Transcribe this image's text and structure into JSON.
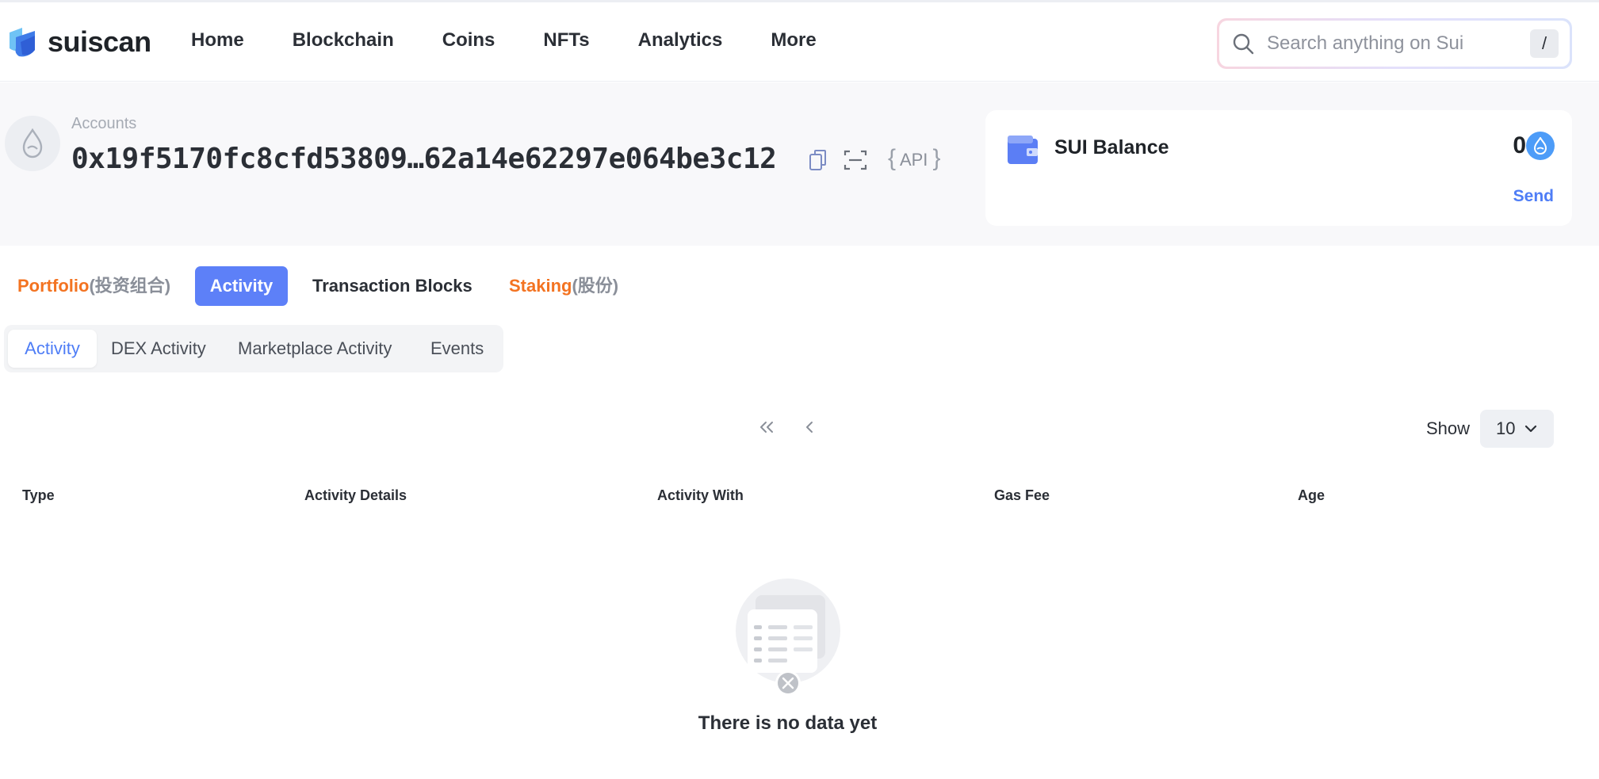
{
  "brand": {
    "name": "suiscan"
  },
  "nav": {
    "items": [
      {
        "label": "Home"
      },
      {
        "label": "Blockchain"
      },
      {
        "label": "Coins"
      },
      {
        "label": "NFTs"
      },
      {
        "label": "Analytics"
      },
      {
        "label": "More"
      }
    ]
  },
  "search": {
    "placeholder": "Search anything on Sui",
    "shortcut": "/"
  },
  "account": {
    "label": "Accounts",
    "address": "0x19f5170fc8cfd53809…62a14e62297e064be3c12",
    "api_label": "API"
  },
  "balance": {
    "title": "SUI Balance",
    "value": "0",
    "send_label": "Send"
  },
  "main_tabs": {
    "portfolio": {
      "label": "Portfolio",
      "suffix": "(投资组合)"
    },
    "activity": {
      "label": "Activity"
    },
    "tx_blocks": {
      "label": "Transaction Blocks"
    },
    "staking": {
      "label": "Staking",
      "suffix": "(股份)"
    }
  },
  "sub_tabs": [
    {
      "label": "Activity"
    },
    {
      "label": "DEX Activity"
    },
    {
      "label": "Marketplace Activity"
    },
    {
      "label": "Events"
    }
  ],
  "pagination": {
    "show_label": "Show",
    "page_size": "10"
  },
  "table": {
    "columns": [
      "Type",
      "Activity Details",
      "Activity With",
      "Gas Fee",
      "Age"
    ]
  },
  "empty_state": {
    "message": "There is no data yet"
  },
  "colors": {
    "accent": "#5d80f8",
    "link": "#4e7df6",
    "orange": "#f37321",
    "sui_blue": "#4d9cf8"
  },
  "icons": [
    "suiscan-logo-icon",
    "search-icon",
    "sui-droplet-icon",
    "copy-icon",
    "qr-scan-icon",
    "wallet-icon",
    "sui-coin-icon",
    "double-chevron-left-icon",
    "chevron-left-icon",
    "chevron-down-icon",
    "empty-list-icon"
  ]
}
